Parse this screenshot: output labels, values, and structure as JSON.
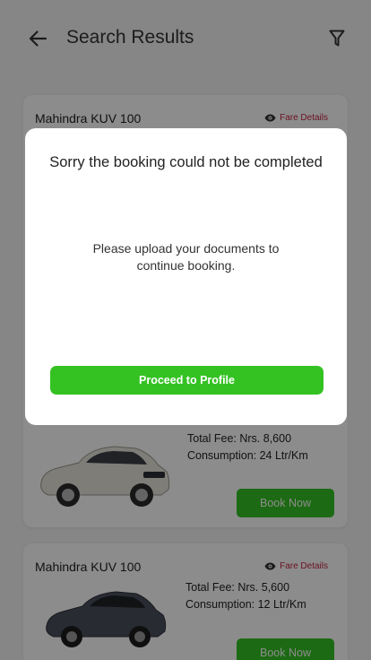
{
  "header": {
    "back_icon": "arrow-left-icon",
    "title": "Search Results",
    "filter_icon": "filter-icon"
  },
  "results": [
    {
      "name": "Mahindra KUV 100",
      "fare_details_label": "Fare Details",
      "total_fee": "Total Fee: Nrs. 8,600",
      "consumption": "Consumption: 24 Ltr/Km",
      "book_label": "Book Now",
      "car_color": "#e6e4da"
    },
    {
      "name": "Mahindra KUV 100",
      "fare_details_label": "Fare Details",
      "total_fee": "Total Fee: Nrs. 5,600",
      "consumption": "Consumption: 12 Ltr/Km",
      "book_label": "Book Now",
      "car_color": "#4a4f5c"
    }
  ],
  "dialog": {
    "title": "Sorry the booking could not be completed",
    "message": "Please upload your documents to continue booking.",
    "button_label": "Proceed to Profile"
  },
  "colors": {
    "accent_green": "#34c223",
    "fare_red": "#c4253f"
  }
}
